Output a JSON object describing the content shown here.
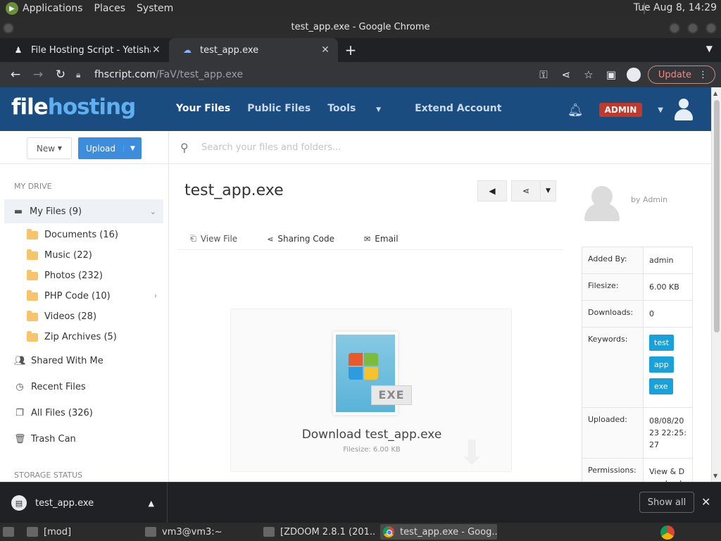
{
  "gnome": {
    "menus": [
      "Applications",
      "Places",
      "System"
    ],
    "clock": "Tue Aug  8, 14:29"
  },
  "window": {
    "title": "test_app.exe - Google Chrome"
  },
  "tabs": [
    {
      "label": "File Hosting Script - Yetishare",
      "active": false
    },
    {
      "label": "test_app.exe",
      "active": true
    }
  ],
  "address": {
    "host": "fhscript.com",
    "path": "/FaV/test_app.exe"
  },
  "toolbar": {
    "update_label": "Update"
  },
  "site": {
    "brand_part1": "file",
    "brand_part2": "hosting",
    "nav": [
      "Your Files",
      "Public Files",
      "Tools",
      "Extend Account"
    ],
    "admin_badge": "ADMIN"
  },
  "sidebar": {
    "new_label": "New",
    "upload_label": "Upload",
    "section_my_drive": "MY DRIVE",
    "my_files": "My Files (9)",
    "folders": [
      "Documents (16)",
      "Music (22)",
      "Photos (232)",
      "PHP Code (10)",
      "Videos (28)",
      "Zip Archives (5)"
    ],
    "shared": "Shared With Me",
    "recent": "Recent Files",
    "all_files": "All Files (326)",
    "trash": "Trash Can",
    "section_storage": "STORAGE STATUS"
  },
  "search": {
    "placeholder": "Search your files and folders..."
  },
  "file": {
    "title": "test_app.exe",
    "tab_view": "View File",
    "tab_sharing": "Sharing Code",
    "tab_email": "Email",
    "icon_tag": "EXE",
    "download_title": "Download test_app.exe",
    "download_size": "Filesize: 6.00 KB",
    "owner": "by Admin"
  },
  "meta": {
    "added_by_label": "Added By:",
    "added_by": "admin",
    "filesize_label": "Filesize:",
    "filesize": "6.00 KB",
    "downloads_label": "Downloads:",
    "downloads": "0",
    "keywords_label": "Keywords:",
    "keywords": [
      "test",
      "app",
      "exe"
    ],
    "uploaded_label": "Uploaded:",
    "uploaded": "08/08/2023 22:25:27",
    "permissions_label": "Permissions:",
    "permissions": "View & Download"
  },
  "shelf": {
    "filename": "test_app.exe",
    "show_all": "Show all"
  },
  "taskbar": {
    "items": [
      "[mod]",
      "vm3@vm3:~",
      "[ZDOOM 2.8.1 (201...",
      "test_app.exe - Goog..."
    ]
  }
}
